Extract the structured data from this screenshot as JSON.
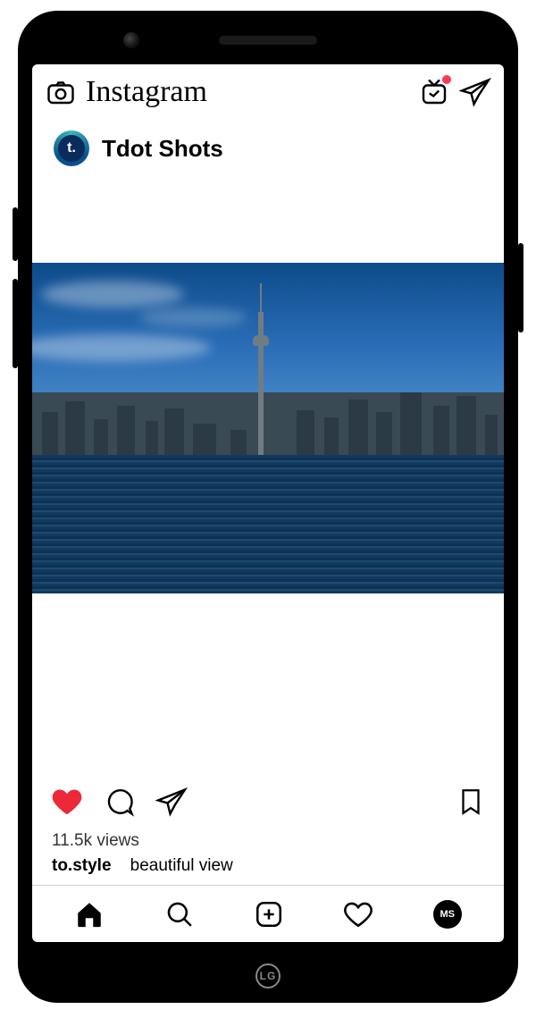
{
  "header": {
    "app_name": "Instagram",
    "igtv_has_notification": true
  },
  "post": {
    "author": "Tdot Shots",
    "avatar_letter": "t.",
    "views_text": "11.5k views",
    "liked": true,
    "comment": {
      "user": "to.style",
      "text": "beautiful view"
    }
  },
  "nav": {
    "profile_initials": "MS"
  },
  "phone_brand": "LG"
}
